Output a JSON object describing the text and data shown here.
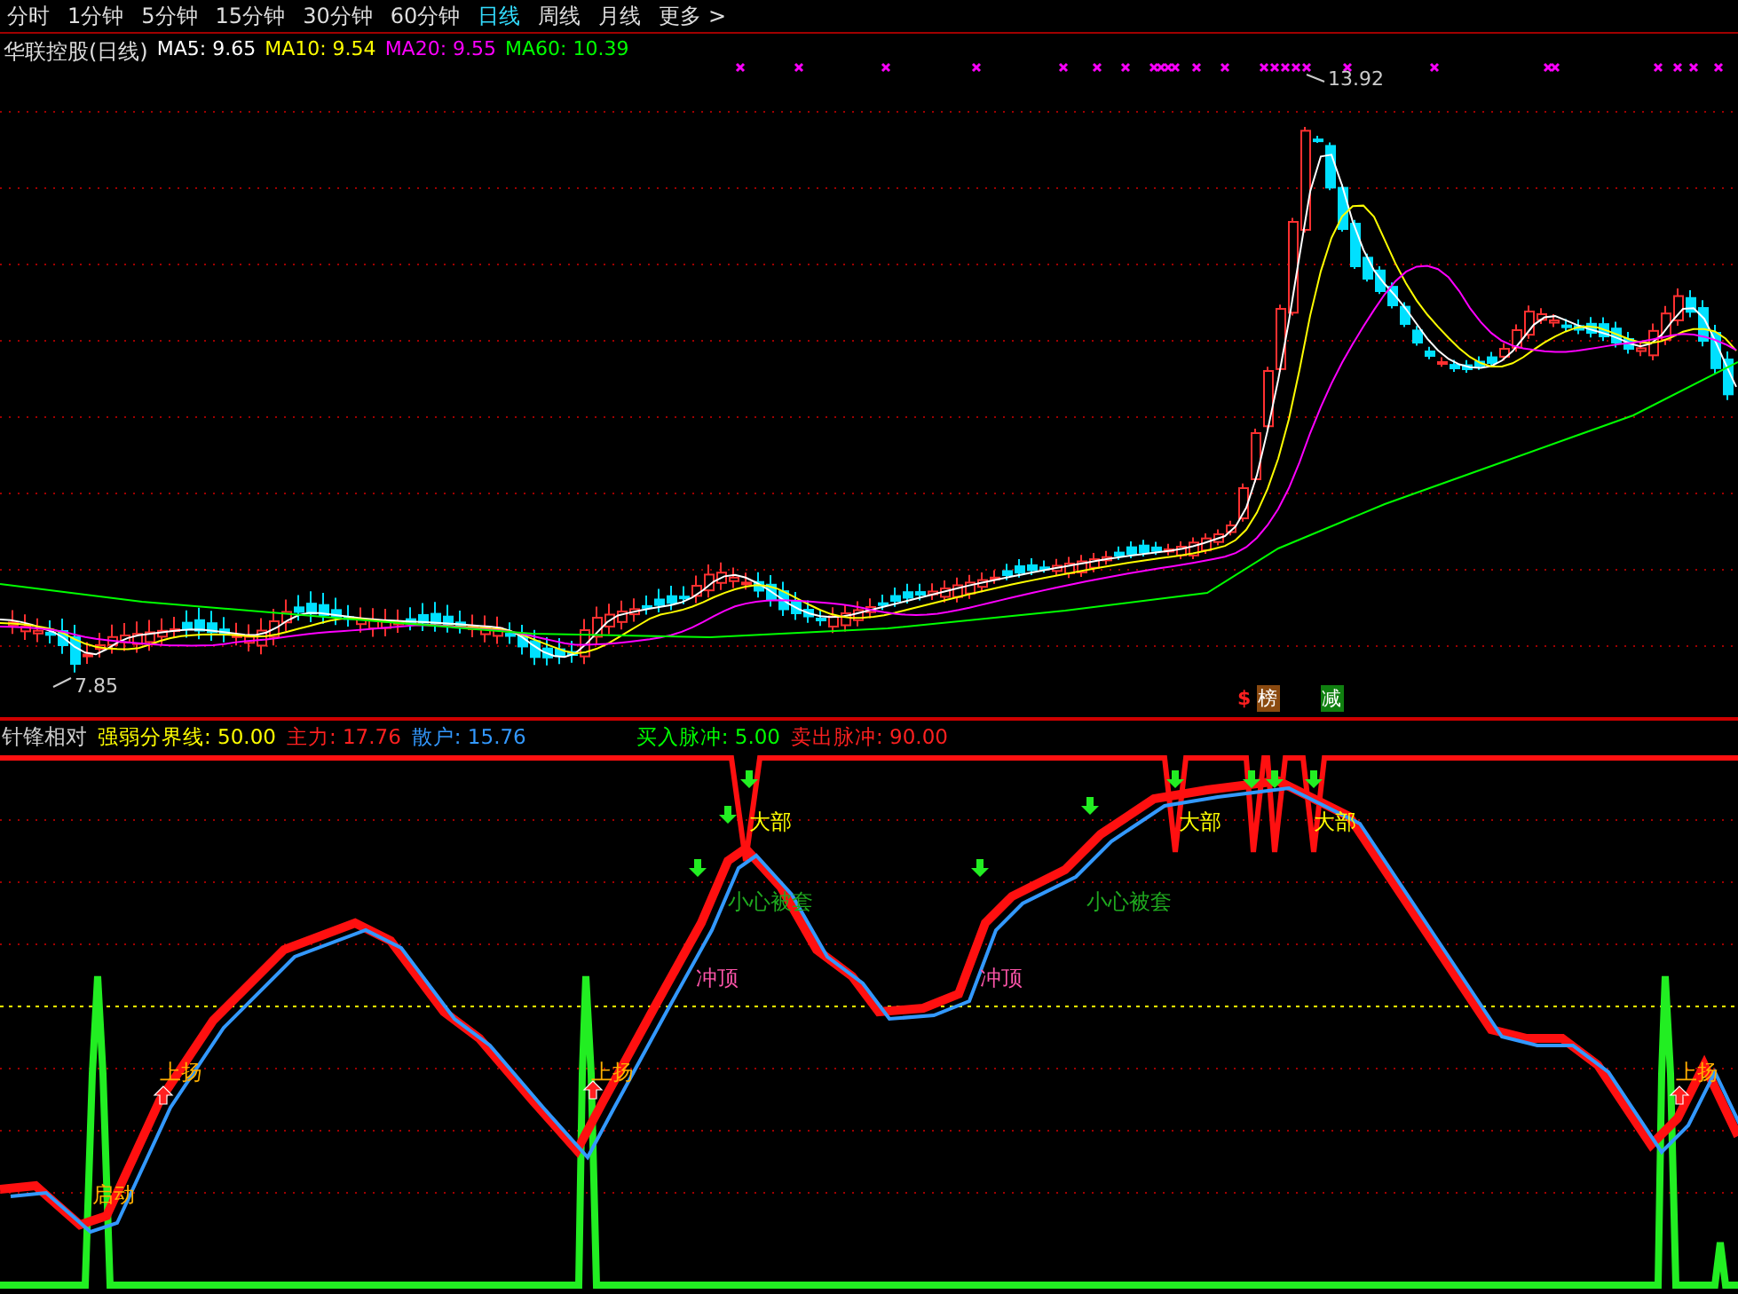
{
  "periods": [
    {
      "label": "分时",
      "selected": false
    },
    {
      "label": "1分钟",
      "selected": false
    },
    {
      "label": "5分钟",
      "selected": false
    },
    {
      "label": "15分钟",
      "selected": false
    },
    {
      "label": "30分钟",
      "selected": false
    },
    {
      "label": "60分钟",
      "selected": false
    },
    {
      "label": "日线",
      "selected": true
    },
    {
      "label": "周线",
      "selected": false
    },
    {
      "label": "月线",
      "selected": false
    },
    {
      "label": "更多 >",
      "selected": false
    }
  ],
  "price_chart": {
    "title": "华联控股(日线)",
    "legend": [
      {
        "text": "MA5: 9.65",
        "color": "#ffffff"
      },
      {
        "text": "MA10: 9.54",
        "color": "#ffff00"
      },
      {
        "text": "MA20: 9.55",
        "color": "#ff00ff"
      },
      {
        "text": "MA60: 10.39",
        "color": "#00ff00"
      }
    ],
    "high_label": "13.92",
    "low_label": "7.85",
    "badges": [
      {
        "text": "$",
        "kind": "mark"
      },
      {
        "text": "榜",
        "kind": "tag",
        "color": "#8b4a10"
      },
      {
        "text": "减",
        "kind": "tag",
        "color": "#108010"
      }
    ]
  },
  "indicator": {
    "name": "针锋相对",
    "legend": [
      {
        "text": "强弱分界线: 50.00",
        "color": "#ffff00"
      },
      {
        "text": "主力: 17.76",
        "color": "#ff2020"
      },
      {
        "text": "散户: 15.76",
        "color": "#3399ff"
      },
      {
        "text": "买入脉冲: 5.00",
        "color": "#00ff00"
      },
      {
        "text": "卖出脉冲: 90.00",
        "color": "#ff2020"
      }
    ],
    "labels": [
      {
        "text": "大部",
        "kind": "top"
      },
      {
        "text": "大部",
        "kind": "top"
      },
      {
        "text": "大部",
        "kind": "top"
      },
      {
        "text": "小心被套",
        "kind": "caution"
      },
      {
        "text": "小心被套",
        "kind": "caution"
      },
      {
        "text": "冲顶",
        "kind": "rush"
      },
      {
        "text": "冲顶",
        "kind": "rush"
      },
      {
        "text": "上扬",
        "kind": "rise"
      },
      {
        "text": "上扬",
        "kind": "rise"
      },
      {
        "text": "上扬",
        "kind": "rise"
      },
      {
        "text": "启动",
        "kind": "start"
      }
    ]
  }
}
